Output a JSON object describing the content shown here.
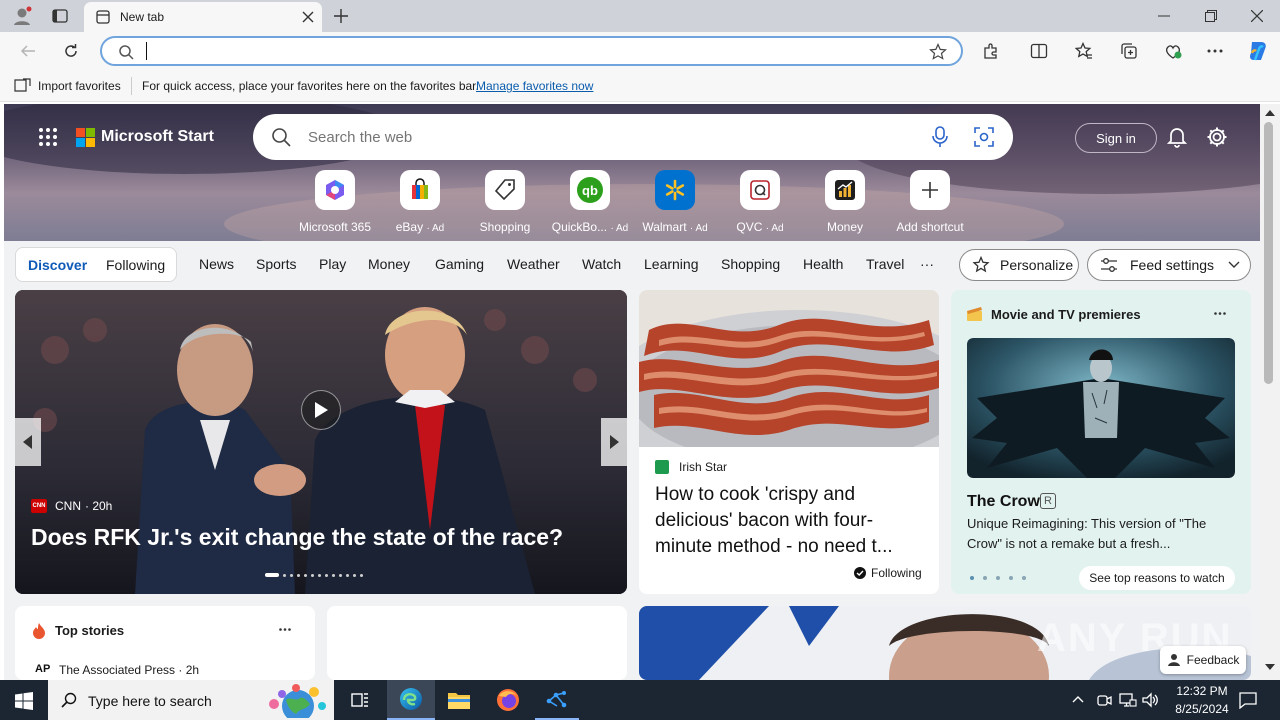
{
  "browser": {
    "tab_title": "New tab",
    "address_value": "",
    "import_favorites": "Import favorites",
    "favorites_hint": "For quick access, place your favorites here on the favorites bar.",
    "manage_favorites": "Manage favorites now"
  },
  "header": {
    "brand": "Microsoft Start",
    "search_placeholder": "Search the web",
    "sign_in": "Sign in"
  },
  "shortcuts": [
    {
      "label": "Microsoft 365",
      "icon": "microsoft-365-icon"
    },
    {
      "label": "eBay",
      "ad": "· Ad",
      "icon": "ebay-icon"
    },
    {
      "label": "Shopping",
      "icon": "tag-icon"
    },
    {
      "label": "QuickBo...",
      "ad": "· Ad",
      "icon": "quickbooks-icon"
    },
    {
      "label": "Walmart",
      "ad": "· Ad",
      "icon": "walmart-icon"
    },
    {
      "label": "QVC",
      "ad": "· Ad",
      "icon": "qvc-icon"
    },
    {
      "label": "Money",
      "icon": "money-icon"
    },
    {
      "label": "Add shortcut",
      "icon": "plus-icon"
    }
  ],
  "feed_nav": {
    "discover": "Discover",
    "following": "Following",
    "items": [
      "News",
      "Sports",
      "Play",
      "Money",
      "Gaming",
      "Weather",
      "Watch",
      "Learning",
      "Shopping",
      "Health",
      "Travel"
    ],
    "more": "···",
    "personalize": "Personalize",
    "feed_settings": "Feed settings"
  },
  "hero_story": {
    "source": "CNN",
    "age": "· 20h",
    "headline": "Does RFK Jr.'s exit change the state of the race?"
  },
  "bacon_card": {
    "source": "Irish Star",
    "headline": "How to cook 'crispy and delicious' bacon with four-minute method - no need t...",
    "following": "Following"
  },
  "movie_card": {
    "section": "Movie and TV premieres",
    "title": "The Crow",
    "rating": "R",
    "description": "Unique Reimagining: This version of \"The Crow\" is not a remake but a fresh...",
    "cta": "See top reasons to watch"
  },
  "top_stories": {
    "title": "Top stories",
    "source_badge": "AP",
    "source": "The Associated Press · 2h"
  },
  "feedback": "Feedback",
  "taskbar": {
    "search_placeholder": "Type here to search",
    "time": "12:32 PM",
    "date": "8/25/2024"
  },
  "watermark": "ANY RUN"
}
